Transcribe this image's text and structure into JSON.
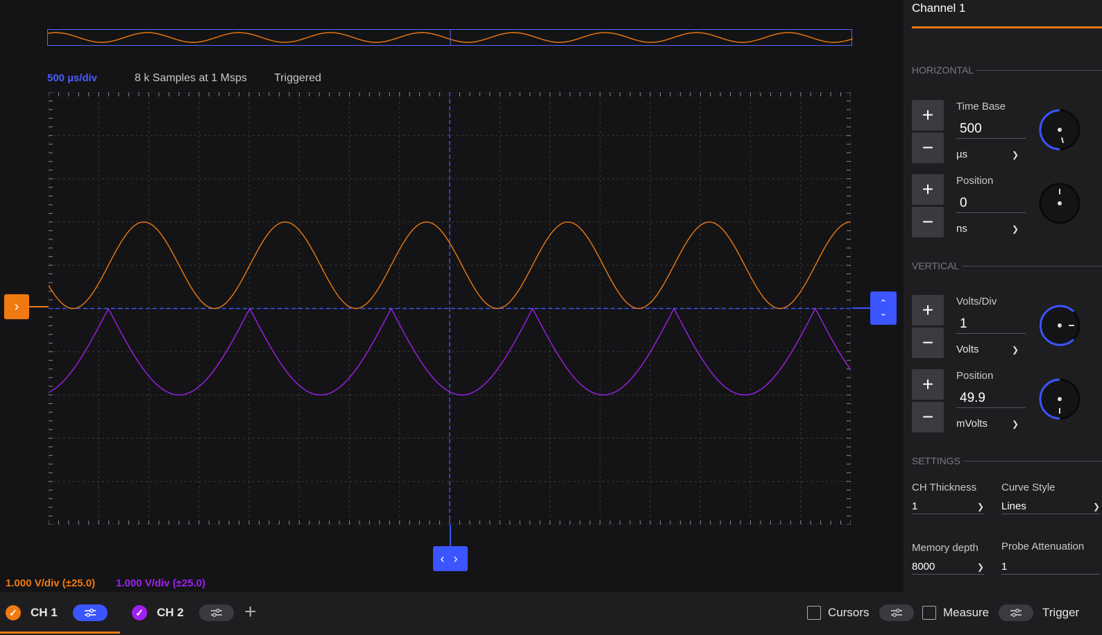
{
  "status": {
    "timebase": "500 µs/div",
    "samples": "8 k Samples at 1 Msps",
    "trigger_state": "Triggered"
  },
  "channel_scales": {
    "ch1": "1.000 V/div (±25.0)",
    "ch2": "1.000 V/div (±25.0)"
  },
  "colors": {
    "ch1": "#f07a12",
    "ch2": "#a020f0",
    "accent": "#3b55ff",
    "background": "#141416",
    "panel": "#1e1e21"
  },
  "markers": {
    "channel_offset": "›",
    "trigger_up": "⌃",
    "trigger_down": "⌄",
    "horizontal_position": "‹ ›"
  },
  "panel": {
    "title": "Channel 1",
    "horizontal": {
      "section_label": "HORIZONTAL",
      "time_base": {
        "label": "Time Base",
        "value": "500",
        "unit": "µs"
      },
      "position": {
        "label": "Position",
        "value": "0",
        "unit": "ns"
      }
    },
    "vertical": {
      "section_label": "VERTICAL",
      "volts_div": {
        "label": "Volts/Div",
        "value": "1",
        "unit": "Volts"
      },
      "position": {
        "label": "Position",
        "value": "49.9",
        "unit": "mVolts"
      }
    },
    "settings": {
      "section_label": "SETTINGS",
      "ch_thickness": {
        "label": "CH Thickness",
        "value": "1"
      },
      "curve_style": {
        "label": "Curve Style",
        "value": "Lines"
      },
      "memory_depth": {
        "label": "Memory depth",
        "value": "8000"
      },
      "probe_attenuation": {
        "label": "Probe Attenuation",
        "value": "1"
      }
    }
  },
  "bottom_bar": {
    "tabs": [
      {
        "label": "CH 1",
        "enabled": true
      },
      {
        "label": "CH 2",
        "enabled": true
      }
    ],
    "add_icon": "+",
    "cursors_label": "Cursors",
    "measure_label": "Measure",
    "trigger_label": "Trigger"
  },
  "chart_data": {
    "type": "line",
    "xlabel": "",
    "ylabel": "",
    "divisions_x": 16,
    "divisions_y": 10,
    "grid": true,
    "xlim": [
      -4000,
      4000
    ],
    "ylim": [
      -5,
      5
    ],
    "x_unit": "µs",
    "y_unit": "V",
    "series": [
      {
        "waveform": "sine",
        "color": "#f07a12",
        "period_us": 1410,
        "amplitude_v": 1.0,
        "offset_v": 1.0
      },
      {
        "waveform": "full-wave-rectified-sine",
        "color": "#a020f0",
        "period_us": 1410,
        "amplitude_v": 2.0,
        "offset_v": 0
      }
    ]
  }
}
